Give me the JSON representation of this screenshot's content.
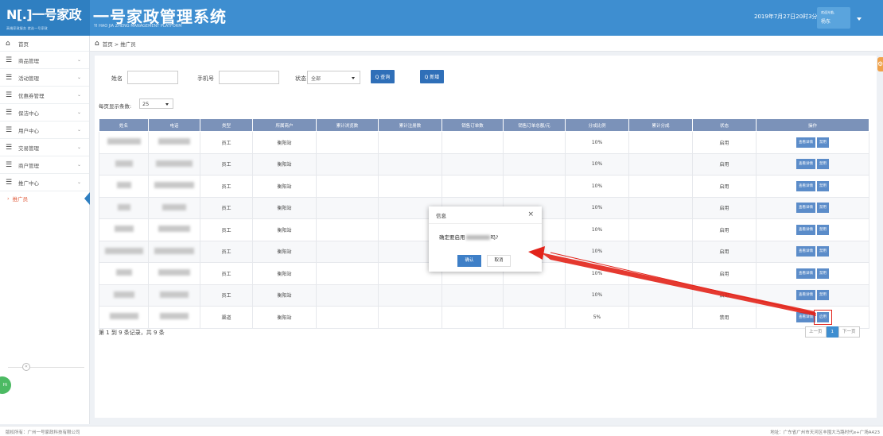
{
  "header": {
    "logo_main": "N[.]一号家政",
    "logo_sub": "高端家政服务 就选一号家政",
    "title": "一号家政管理系统",
    "subtitle": "YI HAO JIA ZHENG MANAGEMENT PLATFORM",
    "datetime": "2019年7月27日20时3分51秒",
    "user_greeting": "欢迎光临,",
    "user_name": "杨东"
  },
  "sidebar": {
    "home": "首页",
    "items": [
      {
        "label": "商品管理"
      },
      {
        "label": "活动管理"
      },
      {
        "label": "优惠券管理"
      },
      {
        "label": "保洁中心"
      },
      {
        "label": "用户中心"
      },
      {
        "label": "交易管理"
      },
      {
        "label": "商户管理"
      },
      {
        "label": "推广中心"
      }
    ],
    "active_sub": "推广员",
    "collapse_icon": "«"
  },
  "breadcrumb": "首页 > 推广员",
  "search": {
    "name_label": "姓名",
    "phone_label": "手机号",
    "status_label": "状态",
    "status_value": "全部",
    "query_btn": "Q 查询",
    "add_btn": "Q 新增"
  },
  "perpage": {
    "label": "每页显示条数:",
    "value": "25"
  },
  "table": {
    "headers": [
      "姓名",
      "电话",
      "类型",
      "所属商户",
      "累计浏览数",
      "累计注册数",
      "销售订单数",
      "销售订单总额/元",
      "分成比例",
      "累计分成",
      "状态",
      "操作"
    ],
    "rows": [
      {
        "type": "员工",
        "merchant": "衡阳站",
        "ratio": "10%",
        "status": "启用",
        "op1": "查看详情",
        "op2": "禁用"
      },
      {
        "type": "员工",
        "merchant": "衡阳站",
        "ratio": "10%",
        "status": "启用",
        "op1": "查看详情",
        "op2": "禁用"
      },
      {
        "type": "员工",
        "merchant": "衡阳站",
        "ratio": "10%",
        "status": "启用",
        "op1": "查看详情",
        "op2": "禁用"
      },
      {
        "type": "员工",
        "merchant": "衡阳站",
        "ratio": "10%",
        "status": "启用",
        "op1": "查看详情",
        "op2": "禁用"
      },
      {
        "type": "员工",
        "merchant": "衡阳站",
        "ratio": "10%",
        "status": "启用",
        "op1": "查看详情",
        "op2": "禁用"
      },
      {
        "type": "员工",
        "merchant": "衡阳站",
        "ratio": "10%",
        "status": "启用",
        "op1": "查看详情",
        "op2": "禁用"
      },
      {
        "type": "员工",
        "merchant": "衡阳站",
        "ratio": "10%",
        "status": "启用",
        "op1": "查看详情",
        "op2": "禁用"
      },
      {
        "type": "员工",
        "merchant": "衡阳站",
        "ratio": "10%",
        "status": "启用",
        "op1": "查看详情",
        "op2": "禁用"
      },
      {
        "type": "渠道",
        "merchant": "衡阳站",
        "ratio": "5%",
        "status": "禁用",
        "op1": "查看详情",
        "op2": "启用"
      }
    ]
  },
  "records": "第 1 到 9 条记录，共 9 条",
  "pager": {
    "prev": "上一页",
    "current": "1",
    "next": "下一页"
  },
  "modal": {
    "title": "信息",
    "close": "×",
    "msg_before": "确定要启用",
    "msg_after": "吗?",
    "ok": "确认",
    "cancel": "取消"
  },
  "colors": {
    "accent": "#3e8ed0",
    "highlight": "#e2231a"
  },
  "footer": {
    "left": "版权所有：广州一号家政科技有限公司",
    "right": "地址：广东省广州市天河区丰囤大马路时代e+广场A423"
  }
}
